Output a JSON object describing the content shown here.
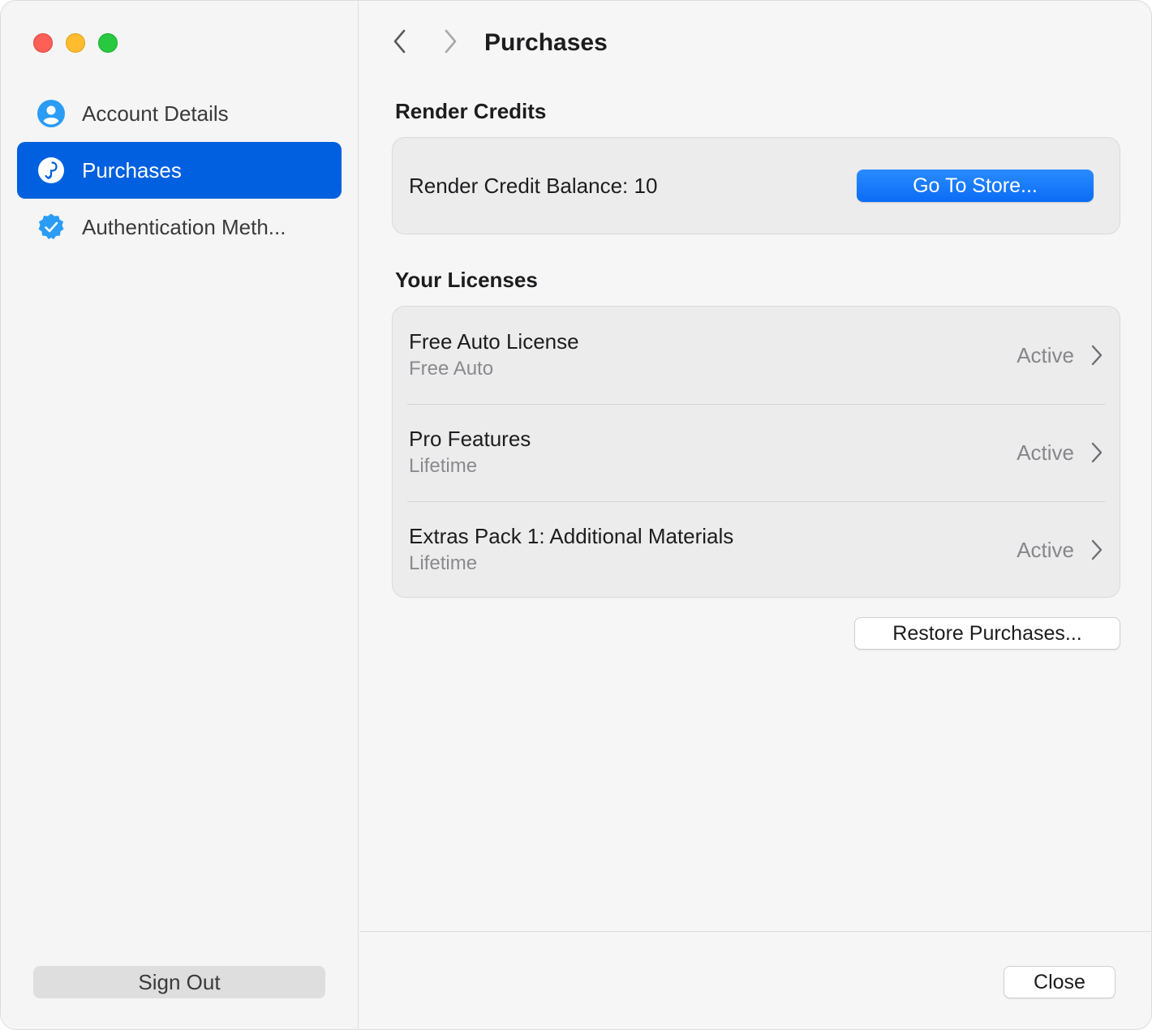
{
  "window": {
    "controls": [
      "close",
      "minimize",
      "zoom"
    ]
  },
  "sidebar": {
    "items": [
      {
        "label": "Account Details",
        "icon": "person-circle-icon",
        "active": false
      },
      {
        "label": "Purchases",
        "icon": "purchases-icon",
        "active": true
      },
      {
        "label": "Authentication Meth...",
        "icon": "checkmark-seal-icon",
        "active": false
      }
    ],
    "sign_out_label": "Sign Out"
  },
  "header": {
    "title": "Purchases",
    "back_icon": "chevron-left-icon",
    "forward_icon": "chevron-right-icon"
  },
  "render_credits": {
    "section_title": "Render Credits",
    "balance_label": "Render Credit Balance: 10",
    "store_button_label": "Go To Store..."
  },
  "licenses": {
    "section_title": "Your Licenses",
    "items": [
      {
        "name": "Free Auto License",
        "type": "Free Auto",
        "status": "Active"
      },
      {
        "name": "Pro Features",
        "type": "Lifetime",
        "status": "Active"
      },
      {
        "name": "Extras Pack 1: Additional Materials",
        "type": "Lifetime",
        "status": "Active"
      }
    ],
    "restore_button_label": "Restore Purchases..."
  },
  "footer": {
    "close_label": "Close"
  },
  "colors": {
    "accent": "#0060df",
    "store_button": "#1a7cff",
    "sidebar_bg": "#f5f5f5",
    "card_bg": "#ececec",
    "icon_blue": "#2a9cf5"
  }
}
